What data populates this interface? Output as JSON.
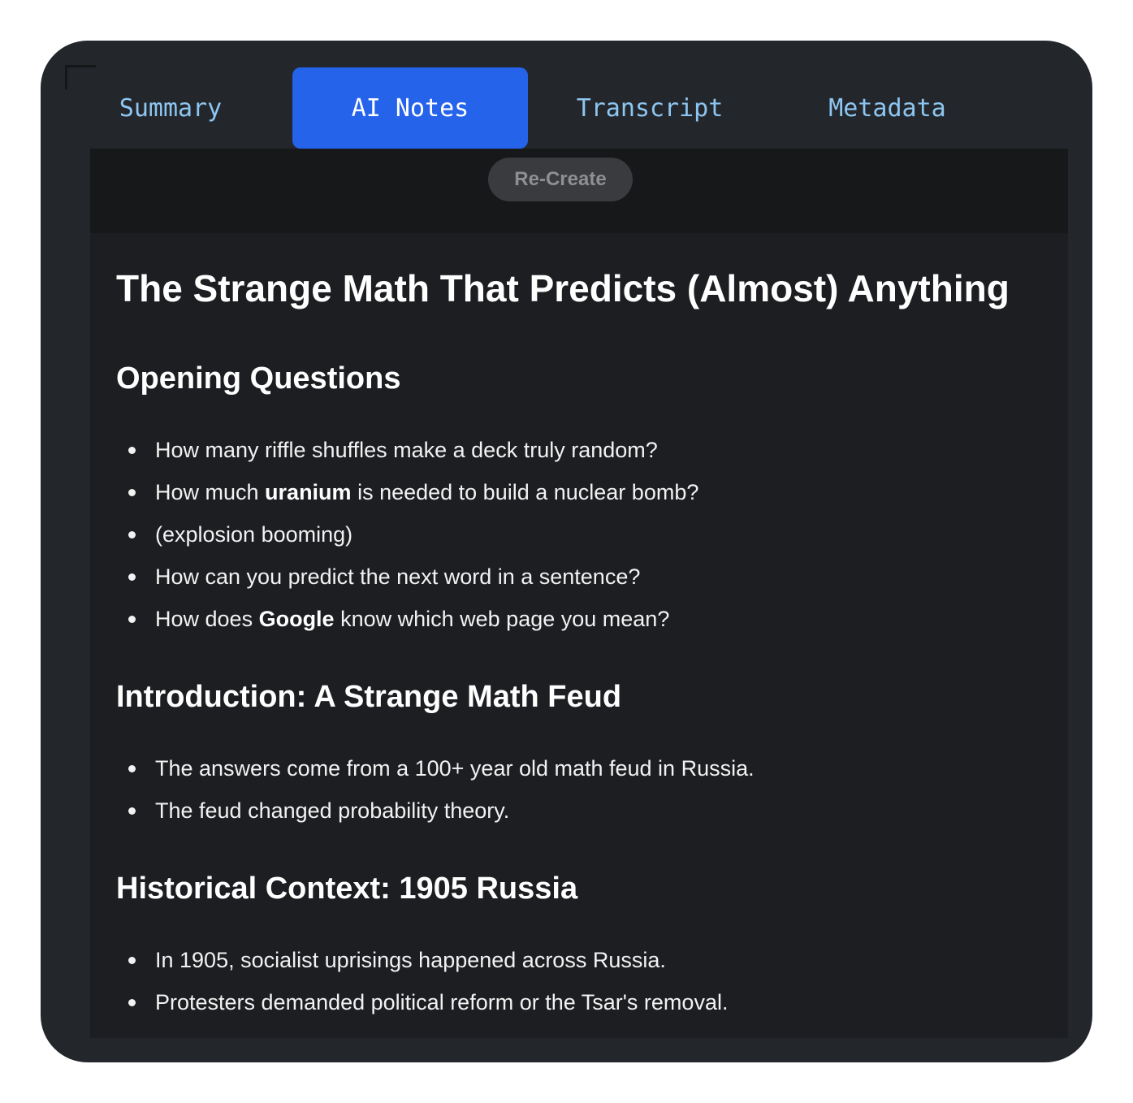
{
  "tabs": [
    {
      "label": "Summary",
      "active": false
    },
    {
      "label": "AI Notes",
      "active": true
    },
    {
      "label": "Transcript",
      "active": false
    },
    {
      "label": "Metadata",
      "active": false
    }
  ],
  "toolbar": {
    "recreate_label": "Re-Create"
  },
  "notes": {
    "title": "The Strange Math That Predicts (Almost) Anything",
    "sections": [
      {
        "heading": "Opening Questions",
        "items": [
          {
            "before": "How many riffle shuffles make a deck truly random?",
            "bold": "",
            "after": ""
          },
          {
            "before": "How much ",
            "bold": "uranium",
            "after": " is needed to build a nuclear bomb?"
          },
          {
            "before": "(explosion booming)",
            "bold": "",
            "after": ""
          },
          {
            "before": "How can you predict the next word in a sentence?",
            "bold": "",
            "after": ""
          },
          {
            "before": "How does ",
            "bold": "Google",
            "after": " know which web page you mean?"
          }
        ]
      },
      {
        "heading": "Introduction: A Strange Math Feud",
        "items": [
          {
            "before": "The answers come from a 100+ year old math feud in Russia.",
            "bold": "",
            "after": ""
          },
          {
            "before": "The feud changed probability theory.",
            "bold": "",
            "after": ""
          }
        ]
      },
      {
        "heading": "Historical Context: 1905 Russia",
        "items": [
          {
            "before": "In 1905, socialist uprisings happened across Russia.",
            "bold": "",
            "after": ""
          },
          {
            "before": "Protesters demanded political reform or the Tsar's removal.",
            "bold": "",
            "after": ""
          }
        ]
      }
    ]
  },
  "colors": {
    "window_bg": "#23272b",
    "content_bg": "#1c1e21",
    "toolbar_bg": "#171819",
    "active_tab": "#2563eb",
    "tab_text": "#8ec6f2"
  }
}
